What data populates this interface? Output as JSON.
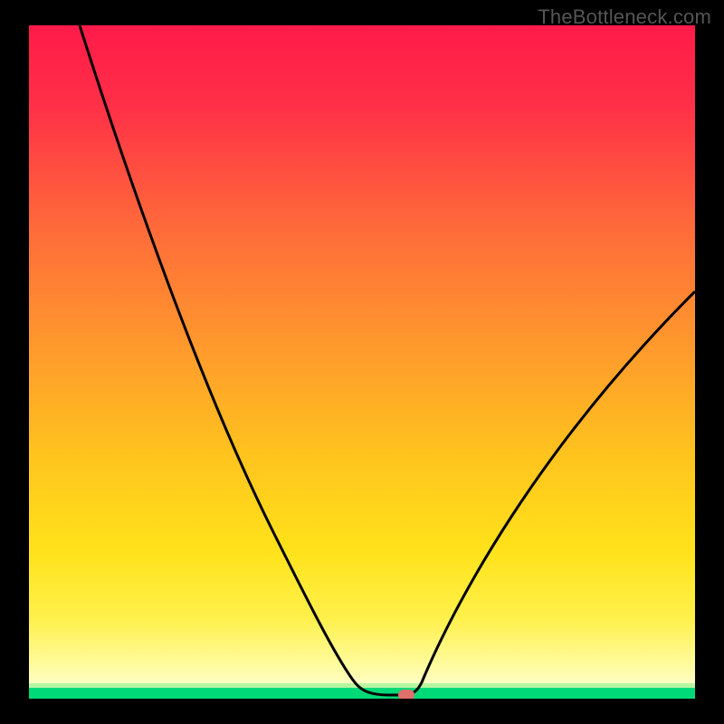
{
  "watermark": "TheBottleneck.com",
  "colors": {
    "gradient_top": "#ff1a49",
    "gradient_mid": "#ffc41e",
    "gradient_low": "#fffb9e",
    "green_band": "#00d977",
    "curve": "#000000",
    "marker": "#e0706d",
    "frame": "#000000"
  },
  "chart_data": {
    "type": "line",
    "title": "",
    "xlabel": "",
    "ylabel": "",
    "xlim": [
      0,
      100
    ],
    "ylim": [
      0,
      100
    ],
    "grid": false,
    "legend": false,
    "annotations": [
      {
        "text": "TheBottleneck.com",
        "role": "watermark",
        "position": "top-right"
      }
    ],
    "series": [
      {
        "name": "bottleneck-curve",
        "x": [
          7,
          15,
          23,
          31,
          38,
          44,
          49,
          53,
          55,
          57,
          59,
          63,
          70,
          80,
          90,
          100
        ],
        "values": [
          100,
          78,
          58,
          40,
          26,
          15,
          7,
          2,
          0,
          0,
          2,
          9,
          23,
          41,
          55,
          61
        ],
        "color": "#000000"
      }
    ],
    "marker": {
      "x": 57,
      "y": 0,
      "color": "#e0706d",
      "shape": "capsule"
    },
    "background_gradient": {
      "direction": "vertical",
      "stops": [
        {
          "pos": 0.0,
          "color": "#ff1a49"
        },
        {
          "pos": 0.3,
          "color": "#ff6a3a"
        },
        {
          "pos": 0.64,
          "color": "#ffc41e"
        },
        {
          "pos": 0.88,
          "color": "#fff04a"
        },
        {
          "pos": 0.98,
          "color": "#b6f6a1"
        },
        {
          "pos": 1.0,
          "color": "#00d977"
        }
      ]
    }
  }
}
